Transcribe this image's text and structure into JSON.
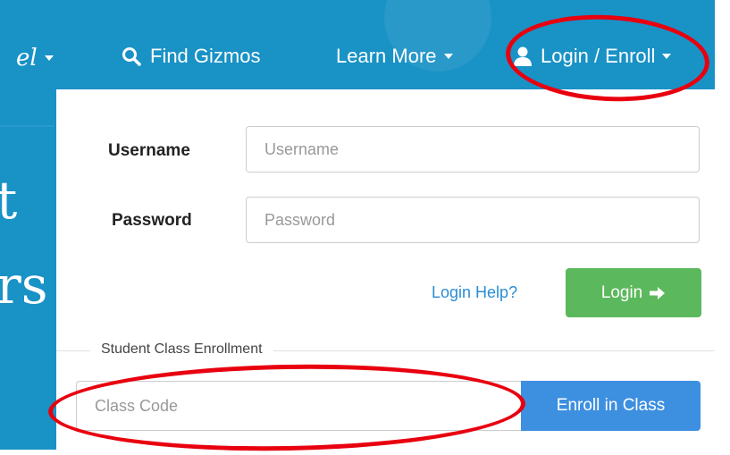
{
  "nav": {
    "logo_text": "el",
    "find_label": "Find Gizmos",
    "learn_label": "Learn More",
    "login_label": "Login / Enroll"
  },
  "hero": {
    "line1": "t",
    "line2": "rs"
  },
  "login_form": {
    "username_label": "Username",
    "username_placeholder": "Username",
    "password_label": "Password",
    "password_placeholder": "Password",
    "help_link": "Login Help?",
    "login_button": "Login"
  },
  "enrollment": {
    "legend": "Student Class Enrollment",
    "class_code_placeholder": "Class Code",
    "enroll_button": "Enroll in Class"
  },
  "colors": {
    "nav_bg": "#1992c6",
    "login_green": "#5cb85c",
    "enroll_blue": "#3d8fe0",
    "highlight_red": "#e8000f"
  },
  "icons": [
    "search-icon",
    "user-icon",
    "arrow-right-icon",
    "caret-down-icon"
  ]
}
